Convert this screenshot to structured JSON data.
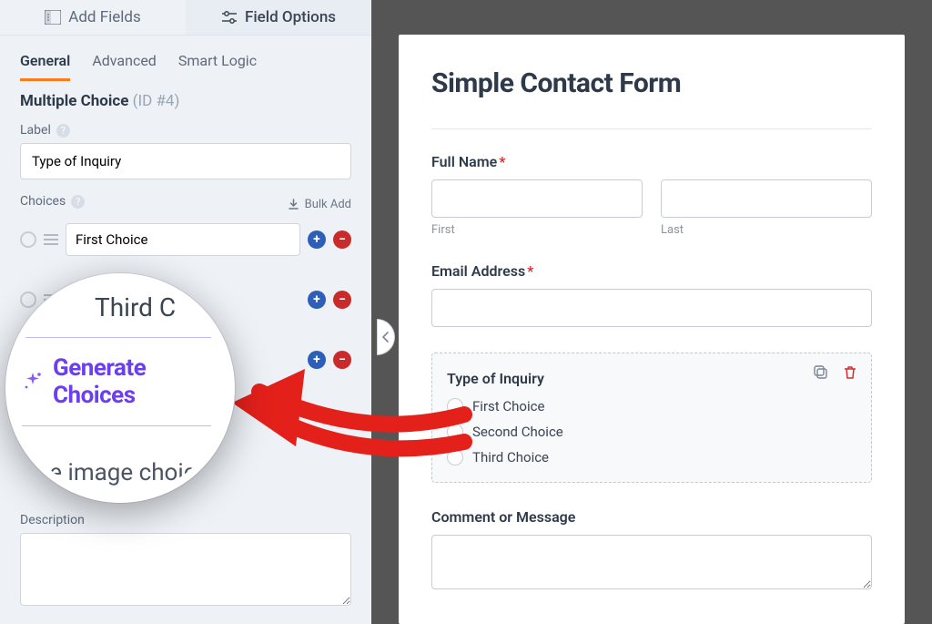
{
  "top_tabs": {
    "add_fields": "Add Fields",
    "field_options": "Field Options"
  },
  "subtabs": {
    "general": "General",
    "advanced": "Advanced",
    "smart_logic": "Smart Logic"
  },
  "field": {
    "type": "Multiple Choice",
    "id_label": "(ID #4)",
    "label_label": "Label",
    "label_value": "Type of Inquiry",
    "choices_label": "Choices",
    "bulk_add": "Bulk Add",
    "choices": [
      "First Choice",
      "Second Choice",
      "Third Choice"
    ],
    "description_label": "Description"
  },
  "magnifier": {
    "partial": "Third C",
    "generate": "Generate Choices",
    "image_choice": "Use image choic"
  },
  "preview": {
    "title": "Simple Contact Form",
    "full_name": "Full Name",
    "first": "First",
    "last": "Last",
    "email": "Email Address",
    "inquiry_label": "Type of Inquiry",
    "inquiry_options": [
      "First Choice",
      "Second Choice",
      "Third Choice"
    ],
    "comment": "Comment or Message"
  }
}
